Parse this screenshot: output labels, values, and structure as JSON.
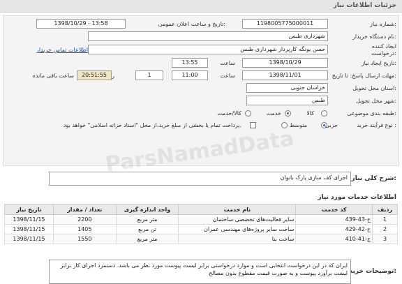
{
  "header": {
    "title": "جزئیات اطلاعات نیاز"
  },
  "form": {
    "need_number_label": "شماره نیاز:",
    "need_number": "1198005775000011",
    "announce_label": "تاریخ و ساعت اعلان عمومی:",
    "announce_value": "1398/10/29 - 13:58",
    "buyer_org_label": "نام دستگاه خریدار:",
    "buyer_org": "شهرداری طبس",
    "requester_label_1": "ایجاد کننده",
    "requester_label_2": "درخواست:",
    "requester": "حسن یونگه کارپرداز شهرداری طبس",
    "contact_link": "اطلاعات تماس خریدار",
    "created_label": "تاریخ ایجاد نیاز:",
    "created_date": "1398/10/29",
    "created_time_label": "ساعت",
    "created_time": "13:55",
    "deadline_label": "مهلت ارسال پاسخ: تا تاریخ:",
    "deadline_date": "1398/11/01",
    "deadline_time_label": "ساعت",
    "deadline_time": "11:00",
    "days": "1",
    "days_label": "روز و",
    "remaining": "20:51:55",
    "remaining_label": "ساعت باقی مانده",
    "province_label": "استان محل تحویل:",
    "province": "خراسان جنوبی",
    "city_label": "شهر محل تحویل:",
    "city": "طبس",
    "category_label": "طبقه بندی موضوعی:",
    "category_options": [
      "کالا",
      "خدمت",
      "کالا/خدمت"
    ],
    "purchase_label": "نوع فرآیند خرید :",
    "purchase_options": [
      "جزیی",
      "متوسط"
    ],
    "payment_text": "پرداخت تمام یا بخشی از مبلغ خرید،از محل \"اسناد خزانه اسلامی\" خواهد بود."
  },
  "general_desc_label": "شرح کلی نیاز:",
  "general_desc": "اجرای کف سازی پارک بانوان",
  "services_title": "اطلاعات خدمات مورد نیاز",
  "table": {
    "headers": [
      "ردیف",
      "کد خدمت",
      "نام خدمت",
      "واحد اندازه گیری",
      "تعداد / مقدار",
      "تاریخ نیاز"
    ],
    "rows": [
      [
        "1",
        "ج-43-439",
        "سایر فعالیت‌های تخصصی ساختمان",
        "متر مربع",
        "2200",
        "1398/11/15"
      ],
      [
        "2",
        "ج-42-429",
        "ساخت سایر پروژه‌های مهندسی عمران",
        "تن مربع",
        "1405",
        "1398/11/15"
      ],
      [
        "3",
        "ج-41-410",
        "ساخت بنا",
        "متر مربع",
        "1550",
        "1398/11/15"
      ]
    ]
  },
  "buyer_notes_label": "توضیحات خریدار:",
  "buyer_notes": "ایران کد در این درخواست انتخابی است و موارد درخواستی برابر لیست پیوست مورد نظر می باشد. دستمزد اجرای کار برابر لیست برآورد پیوست و به صورت قیمت مقطوع بدون مصالح",
  "watermark": "ParsNamadData"
}
